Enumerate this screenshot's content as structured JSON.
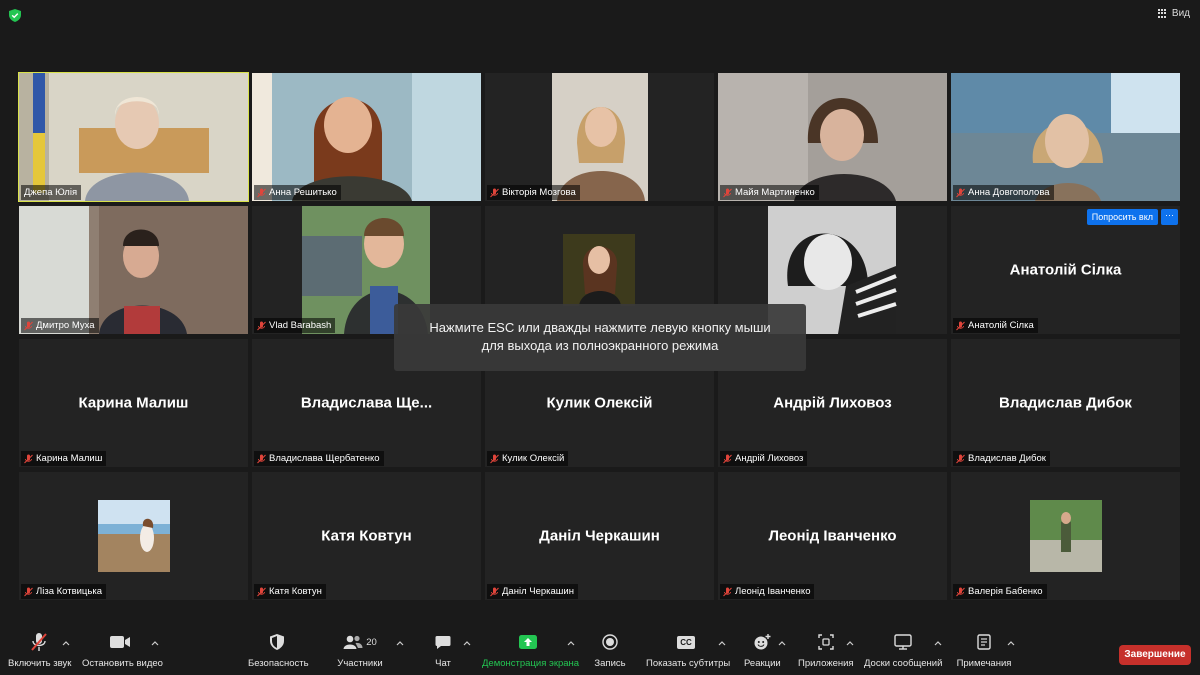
{
  "topbar": {
    "view_label": "Вид"
  },
  "tiles": [
    {
      "label": "Джепа Юлія",
      "muted": false,
      "video": true,
      "active": true
    },
    {
      "label": "Анна Решитько",
      "muted": true,
      "video": true
    },
    {
      "label": "Вікторія Мозгова",
      "muted": true,
      "video": true
    },
    {
      "label": "Майя Мартиненко",
      "muted": true,
      "video": true
    },
    {
      "label": "Анна Довгополова",
      "muted": true,
      "video": true
    },
    {
      "label": "Дмитро Муха",
      "muted": true,
      "video": true
    },
    {
      "label": "Vlad Barabash",
      "muted": true,
      "video": true
    },
    {
      "label": "",
      "muted": false,
      "video": true
    },
    {
      "label": "",
      "muted": false,
      "video": true
    },
    {
      "label": "Анатолій Сілка",
      "bigname": "Анатолій Сілка",
      "muted": true,
      "video": false,
      "request_label": "Попросить вкл",
      "more_label": "···"
    },
    {
      "label": "Карина Малиш",
      "bigname": "Карина Малиш",
      "muted": true,
      "video": false
    },
    {
      "label": "Владислава Щербатенко",
      "bigname": "Владислава  Ще...",
      "muted": true,
      "video": false
    },
    {
      "label": "Кулик Олексій",
      "bigname": "Кулик Олексій",
      "muted": true,
      "video": false
    },
    {
      "label": "Андрій Лиховоз",
      "bigname": "Андрій Лиховоз",
      "muted": true,
      "video": false
    },
    {
      "label": "Владислав Дибок",
      "bigname": "Владислав Дибок",
      "muted": true,
      "video": false
    },
    {
      "label": "Ліза Котвицька",
      "muted": true,
      "video": false,
      "photo": true
    },
    {
      "label": "Катя Ковтун",
      "bigname": "Катя Ковтун",
      "muted": true,
      "video": false
    },
    {
      "label": "Даніл Черкашин",
      "bigname": "Даніл Черкашин",
      "muted": true,
      "video": false
    },
    {
      "label": "Леонід Іванченко",
      "bigname": "Леонід Іванченко",
      "muted": true,
      "video": false
    },
    {
      "label": "Валерія Бабенко",
      "muted": true,
      "video": false,
      "photo": true
    }
  ],
  "overlay": {
    "line1": "Нажмите ESC или дважды нажмите левую кнопку мыши",
    "line2": "для выхода из полноэкранного режима"
  },
  "toolbar": {
    "unmute": "Включить звук",
    "start_video": "Остановить видео",
    "security": "Безопасность",
    "participants": "Участники",
    "participants_count": "20",
    "chat": "Чат",
    "share": "Демонстрация экрана",
    "record": "Запись",
    "captions": "Показать субтитры",
    "captions_icon_text": "CC",
    "reactions": "Реакции",
    "apps": "Приложения",
    "whiteboards": "Доски сообщений",
    "notes": "Примечания",
    "end": "Завершение"
  },
  "colors": {
    "share_green": "#23c552",
    "end_red": "#c6302b",
    "active_speaker": "#d9e24a",
    "muted_red": "#e0453b"
  }
}
